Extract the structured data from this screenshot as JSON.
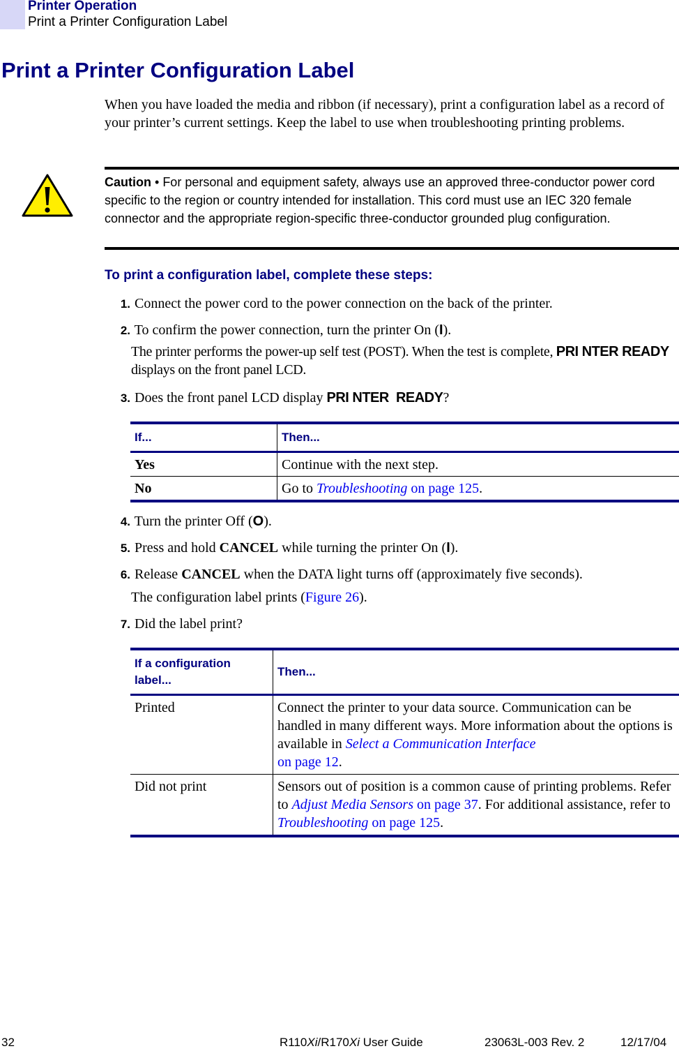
{
  "header": {
    "section": "Printer Operation",
    "subsection": "Print a Printer Configuration Label"
  },
  "title": "Print a Printer Configuration Label",
  "intro": "When you have loaded the media and ribbon (if necessary), print a configuration label as a record of your printer’s current settings. Keep the label to use when troubleshooting printing problems.",
  "caution": {
    "icon": "warning-triangle-icon",
    "label": "Caution",
    "separator": " • ",
    "text": "For personal and equipment safety, always use an approved three-conductor power cord specific to the region or country intended for installation. This cord must use an IEC 320 female connector and the appropriate region-specific three-conductor grounded plug configuration.",
    "colors": {
      "fill": "#ffee00",
      "stroke": "#000000"
    }
  },
  "procedure_heading": "To print a configuration label, complete these steps:",
  "steps": {
    "s1": {
      "num": "1.",
      "text": "Connect the power cord to the power connection on the back of the printer."
    },
    "s2": {
      "num": "2.",
      "pre": "To confirm the power connection, turn the printer On (",
      "symbol": "I",
      "post": ")."
    },
    "s2_note": {
      "pre": "The printer performs the power-up self test (POST). When the test is complete, ",
      "lcd": "PRI NTER READY",
      "post": " displays on the front panel LCD."
    },
    "s3": {
      "num": "3.",
      "pre": "Does the front panel LCD display ",
      "lcd": "PRI NTER  READY",
      "post": "?"
    },
    "s4": {
      "num": "4.",
      "pre": "Turn the printer Off (",
      "symbol": "O",
      "post": ")."
    },
    "s5": {
      "num": "5.",
      "pre": "Press and hold ",
      "bold": "CANCEL",
      "mid": " while turning the printer On (",
      "symbol": "I",
      "post": ")."
    },
    "s6": {
      "num": "6.",
      "pre": "Release ",
      "bold": "CANCEL",
      "post": " when the DATA light turns off (approximately five seconds)."
    },
    "s6_note": {
      "pre": "The configuration label prints (",
      "link": "Figure 26",
      "post": ")."
    },
    "s7": {
      "num": "7.",
      "text": "Did the label print?"
    }
  },
  "table1": {
    "headers": [
      "If...",
      "Then..."
    ],
    "rows": [
      {
        "if": "Yes",
        "then_text": "Continue with the next step."
      },
      {
        "if": "No",
        "then_pre": "Go to ",
        "then_link": "Troubleshooting",
        "then_link2": " on page 125",
        "then_post": "."
      }
    ]
  },
  "table2": {
    "headers": [
      "If a configuration label...",
      "Then..."
    ],
    "rows": [
      {
        "if": "Printed",
        "then_pre": "Connect the printer to your data source. Communication can be handled in many different ways. More information about the options is available in ",
        "then_link": "Select a Communication Interface",
        "then_link2": "on page 12",
        "then_post": "."
      },
      {
        "if": "Did not print",
        "then_pre": "Sensors out of position is a common cause of printing problems. Refer to ",
        "then_link": "Adjust Media Sensors",
        "then_link2": " on page 37",
        "then_mid": ". For additional assistance, refer to ",
        "then_link3": "Troubleshooting",
        "then_link4": " on page 125",
        "then_post": "."
      }
    ]
  },
  "footer": {
    "page_number": "32",
    "guide_model1": "R110",
    "guide_model1_suffix": "Xi",
    "guide_sep": "/R170",
    "guide_model2_suffix": "Xi",
    "guide_rest": " User Guide",
    "doc_rev": "23063L-003 Rev. 2",
    "date": "12/17/04"
  }
}
